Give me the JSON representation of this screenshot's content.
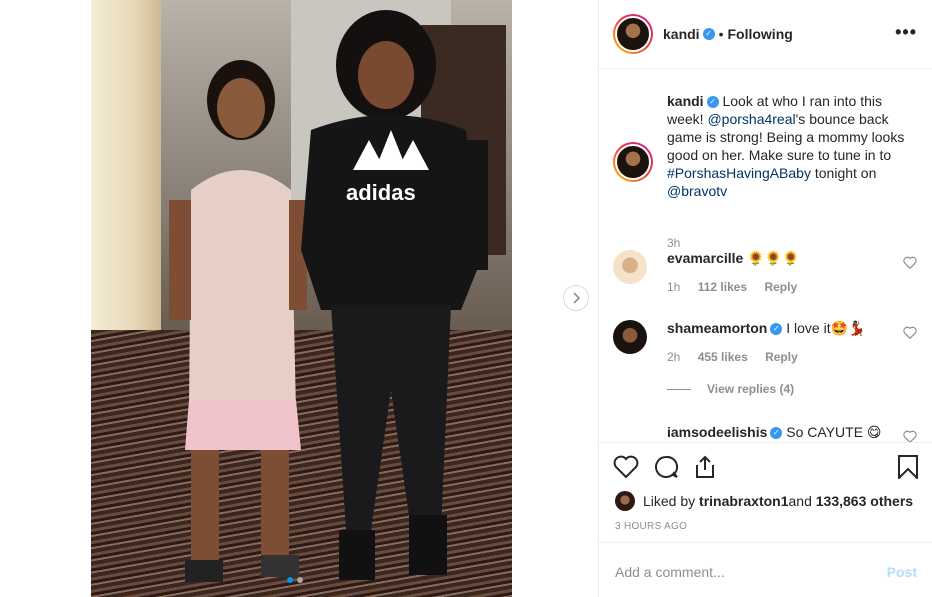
{
  "post": {
    "author": "kandi",
    "follow_separator": "•",
    "follow_status": "Following",
    "more_icon": "more-horizontal-icon"
  },
  "caption": {
    "username": "kandi",
    "text_1": "Look at who I ran into this week! ",
    "mention_1": "@porsha4real",
    "text_2": "'s bounce back game is strong! Being a mommy looks good on her. Make sure to tune in to ",
    "hashtag": "#PorshasHavingABaby",
    "text_3": " tonight on ",
    "mention_2": "@bravotv",
    "time": "3h"
  },
  "comments": [
    {
      "username": "evamarcille",
      "verified": false,
      "text": "🌻🌻🌻",
      "time": "1h",
      "likes": "112 likes",
      "reply": "Reply"
    },
    {
      "username": "shameamorton",
      "verified": true,
      "text": "I love it🤩💃🏾",
      "time": "2h",
      "likes": "455 likes",
      "reply": "Reply"
    },
    {
      "username": "iamsodeelishis",
      "verified": true,
      "text": "So CAYUTE 😋"
    }
  ],
  "view_replies": "View replies (4)",
  "likes_line": {
    "prefix": "Liked by ",
    "user": "trinabraxton1",
    "middle": " and ",
    "count": "133,863 others"
  },
  "timestamp": "3 HOURS AGO",
  "add_comment": {
    "placeholder": "Add a comment...",
    "post_label": "Post"
  },
  "colors": {
    "verified": "#3897f0",
    "link": "#003569",
    "post_disabled": "#b2dffc",
    "active_dot": "#0095f6"
  }
}
